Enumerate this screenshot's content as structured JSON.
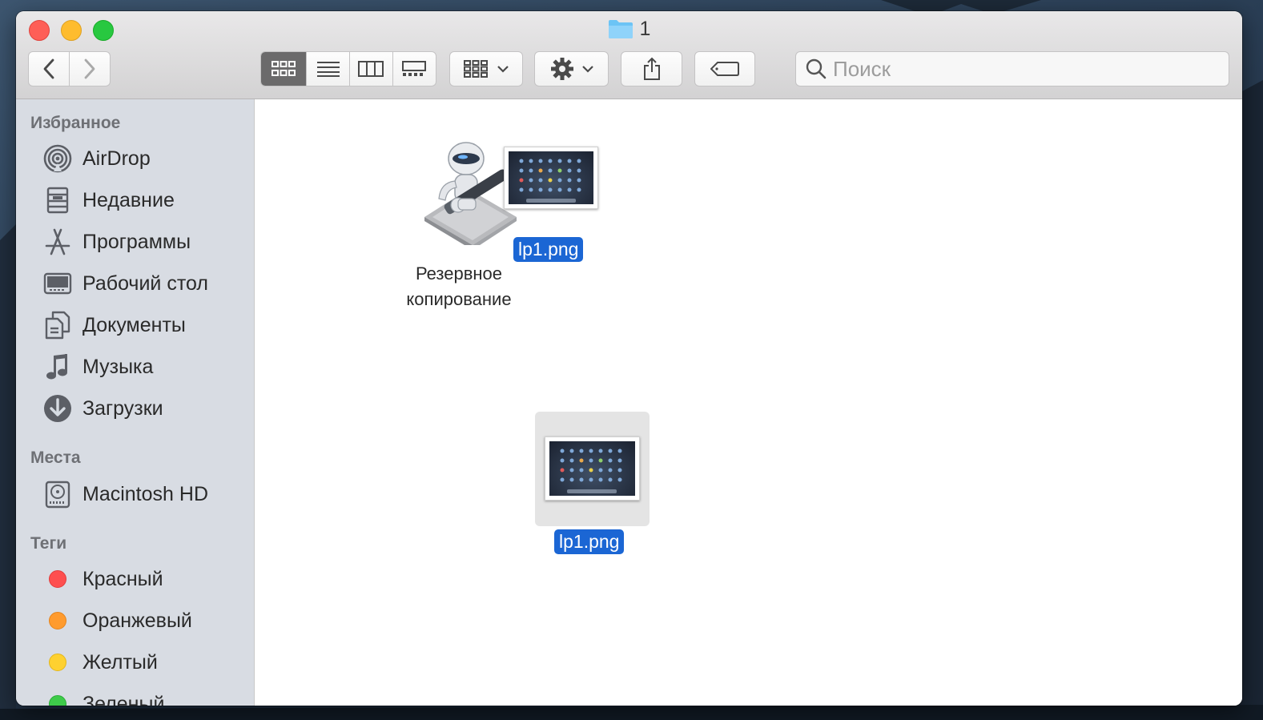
{
  "window": {
    "title": "1"
  },
  "toolbar": {
    "back": "back",
    "forward": "forward",
    "views": [
      "icon-view",
      "list-view",
      "column-view",
      "gallery-view"
    ],
    "active_view": "icon-view",
    "search_placeholder": "Поиск"
  },
  "sidebar": {
    "favorites_title": "Избранное",
    "favorites": [
      {
        "label": "AirDrop",
        "icon": "airdrop-icon"
      },
      {
        "label": "Недавние",
        "icon": "recents-icon"
      },
      {
        "label": "Программы",
        "icon": "applications-icon"
      },
      {
        "label": "Рабочий стол",
        "icon": "desktop-icon"
      },
      {
        "label": "Документы",
        "icon": "documents-icon"
      },
      {
        "label": "Музыка",
        "icon": "music-icon"
      },
      {
        "label": "Загрузки",
        "icon": "downloads-icon"
      }
    ],
    "places_title": "Места",
    "places": [
      {
        "label": "Macintosh HD",
        "icon": "harddisk-icon"
      }
    ],
    "tags_title": "Теги",
    "tags": [
      {
        "label": "Красный",
        "color": "#fe4f4f"
      },
      {
        "label": "Оранжевый",
        "color": "#ff9b2e"
      },
      {
        "label": "Желтый",
        "color": "#fed130"
      },
      {
        "label": "Зеленый",
        "color": "#3ecb4a"
      }
    ]
  },
  "files": {
    "automator_app_label_line1": "Резервное",
    "automator_app_label_line2": "копирование",
    "dragging_file_label": "lp1.png",
    "file_label": "lp1.png"
  },
  "colors": {
    "selection": "#1b66d4"
  }
}
